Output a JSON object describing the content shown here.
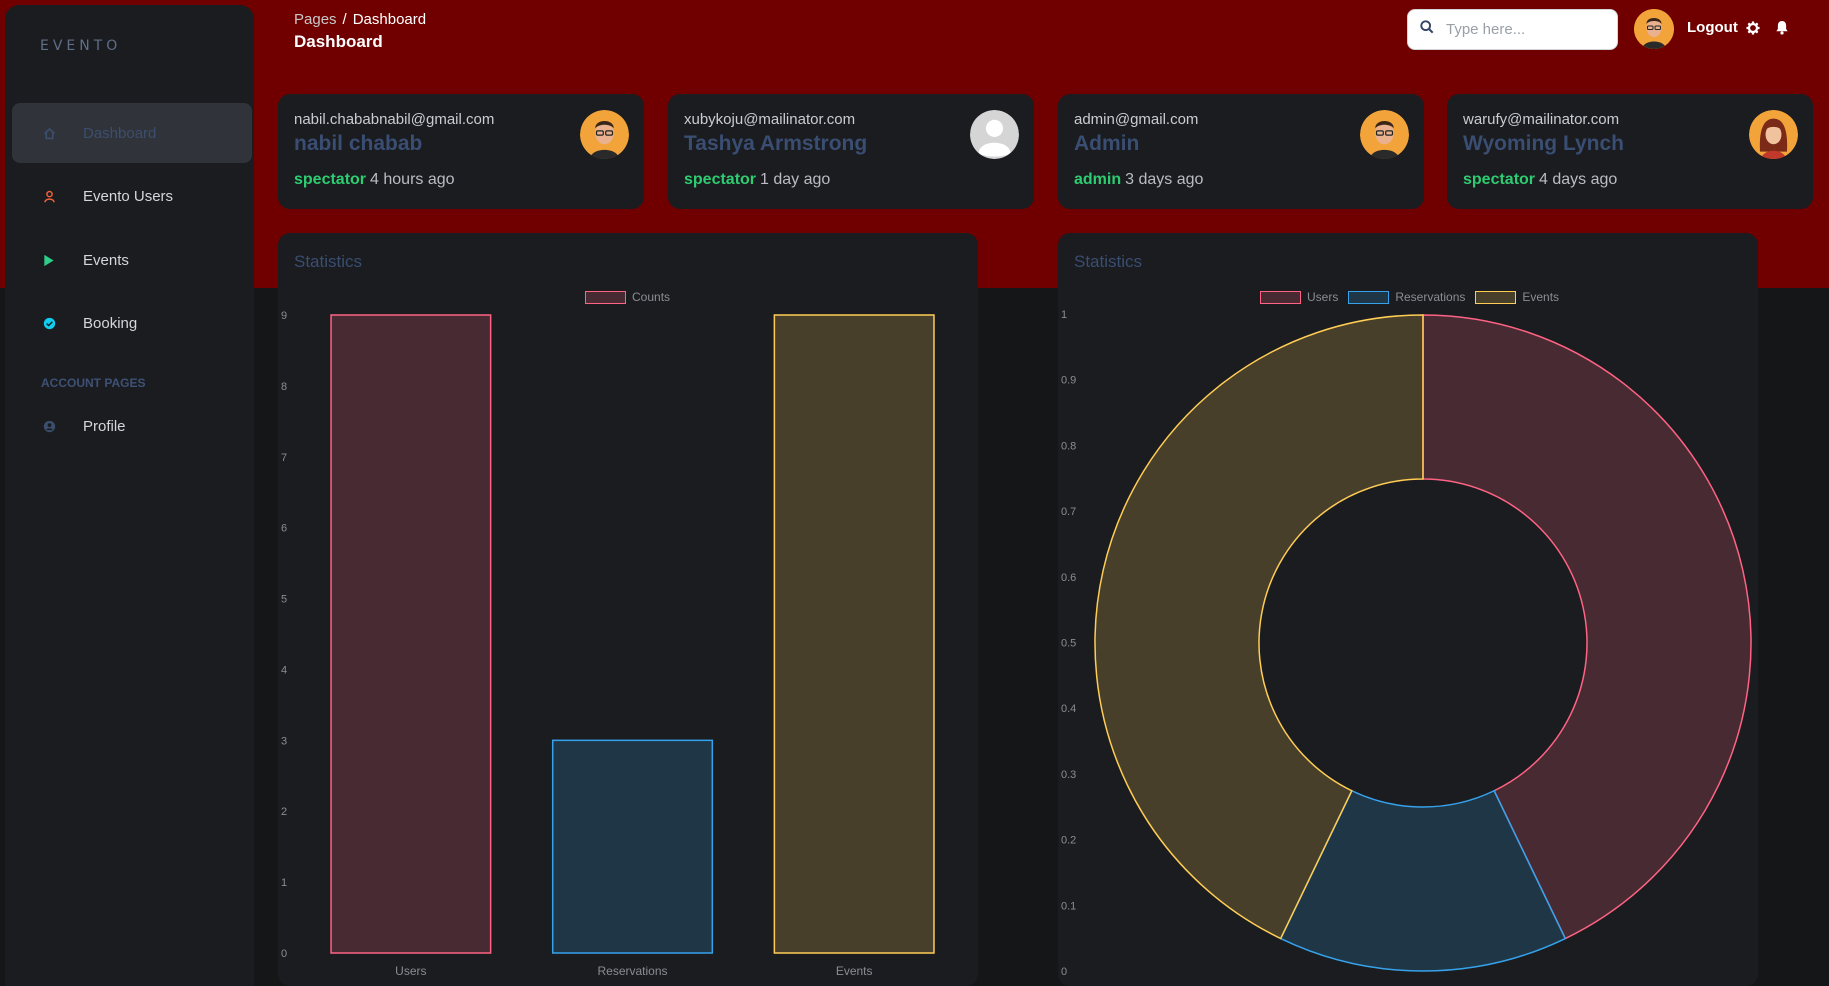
{
  "brand": "EVENTO",
  "sidebar": {
    "items": [
      {
        "label": "Dashboard",
        "icon": "home-icon"
      },
      {
        "label": "Evento Users",
        "icon": "user-icon"
      },
      {
        "label": "Events",
        "icon": "play-icon"
      },
      {
        "label": "Booking",
        "icon": "check-circle-icon"
      }
    ],
    "section_title": "ACCOUNT PAGES",
    "account_items": [
      {
        "label": "Profile",
        "icon": "user-circle-icon"
      }
    ]
  },
  "header": {
    "breadcrumb_root": "Pages",
    "breadcrumb_sep": "/",
    "breadcrumb_current": "Dashboard",
    "title": "Dashboard",
    "search_placeholder": "Type here...",
    "logout_label": "Logout"
  },
  "users": [
    {
      "email": "nabil.chababnabil@gmail.com",
      "name": "nabil chabab",
      "role": "spectator",
      "time": "4 hours ago",
      "avatar": "man-glasses-avatar"
    },
    {
      "email": "xubykoju@mailinator.com",
      "name": "Tashya Armstrong",
      "role": "spectator",
      "time": "1 day ago",
      "avatar": "default-avatar"
    },
    {
      "email": "admin@gmail.com",
      "name": "Admin",
      "role": "admin",
      "time": "3 days ago",
      "avatar": "man-glasses-avatar"
    },
    {
      "email": "warufy@mailinator.com",
      "name": "Wyoming Lynch",
      "role": "spectator",
      "time": "4 days ago",
      "avatar": "woman-avatar"
    }
  ],
  "colors": {
    "users": "#ff6384",
    "reservations": "#36a2eb",
    "events": "#ffcd56",
    "green": "#2ecc71",
    "hero": "#700000"
  },
  "chart_data": [
    {
      "type": "bar",
      "title": "Statistics",
      "categories": [
        "Users",
        "Reservations",
        "Events"
      ],
      "series": [
        {
          "name": "Counts",
          "values": [
            9,
            3,
            9
          ]
        }
      ],
      "ylim": [
        0,
        9
      ],
      "yticks": [
        "0",
        "1",
        "2",
        "3",
        "4",
        "5",
        "6",
        "7",
        "8",
        "9"
      ],
      "legend": "top",
      "grid": false
    },
    {
      "type": "pie",
      "subtype": "doughnut",
      "title": "Statistics",
      "labels": [
        "Users",
        "Reservations",
        "Events"
      ],
      "values": [
        9,
        3,
        9
      ],
      "yticks": [
        "0",
        "0.1",
        "0.2",
        "0.3",
        "0.4",
        "0.5",
        "0.6",
        "0.7",
        "0.8",
        "0.9",
        "1"
      ],
      "legend": "top"
    }
  ]
}
